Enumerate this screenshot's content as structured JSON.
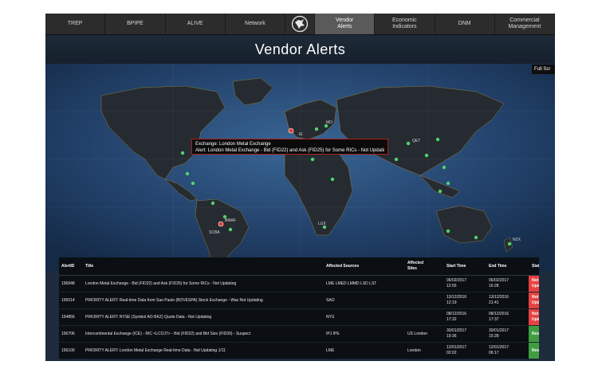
{
  "nav": {
    "items": [
      "TREP",
      "BPIPE",
      "ALIVE",
      "Network"
    ],
    "items_right": [
      "Vendor\nAlerts",
      "Economic\nIndicators",
      "DNM",
      "Commercial\nManagement"
    ]
  },
  "page_title": "Vendor Alerts",
  "fullscreen_label": "Full Scr",
  "tooltip": {
    "line1": "Exchange: London Metal Exchange",
    "line2": "Alert: London Metal Exchange - Bid (FID22) and Ask (FID25) for Some RICs - Not Updating"
  },
  "map_labels": [
    "MO",
    "QET",
    "IE",
    "SCBA",
    "BMAF",
    "NZX",
    "LUX"
  ],
  "table": {
    "headers": [
      "AlertID",
      "Title",
      "Affected Sources",
      "Affected\nSites",
      "Start Time",
      "End Time",
      "Status"
    ],
    "rows": [
      {
        "id": "156948",
        "title": "London Metal Exchange - Bid (FID22) and Ask (FID25) for Some RICs - Not Updating",
        "sources": "LME LMED LMMD LSD LST",
        "sites": "",
        "start": "06/02/2017\n12:55",
        "end": "06/02/2017\n16:28",
        "status": "Not Updating"
      },
      {
        "id": "155014",
        "title": "PRIORITY ALERT: Real-time Data from Sao Paulo (BOVESPA) Stock Exchange - Was Not Updating",
        "sources": "SAO",
        "sites": "",
        "start": "13/12/2016\n12:19",
        "end": "13/12/2016\n21:41",
        "status": "Not Updating"
      },
      {
        "id": "154856",
        "title": "PRIORITY ALERT: NYSE (Symbol AO-BKZ) Quote Data - Not Updating",
        "sources": "NYS",
        "sites": "",
        "start": "08/12/2016\n17:32",
        "end": "08/12/2016\n17:37",
        "status": "Not Updating"
      },
      {
        "id": "156706",
        "title": "Intercontinental Exchange (ICE) - RIC <LCOJ7> - Bid (FID22) and Bid Size (FID30) - Suspect",
        "sources": "IPJ IPE",
        "sites": "US London",
        "start": "30/01/2017\n19:36",
        "end": "30/01/2017\n15:28",
        "status": "Resolved"
      },
      {
        "id": "156100",
        "title": "PRIORITY ALERT: London Metal Exchange Real-time Data - Not Updating 1/11",
        "sources": "LME",
        "sites": "London",
        "start": "12/01/2017\n02:02",
        "end": "12/01/2017\n06:17",
        "status": "Resolved"
      }
    ]
  },
  "colors": {
    "not_updating": "#e84141",
    "resolved": "#3f9d3f",
    "alert_pin": "#e23b2e",
    "ok_pin": "#4fd36b",
    "land": "#2a2f36",
    "ocean": "#2b4a72"
  }
}
